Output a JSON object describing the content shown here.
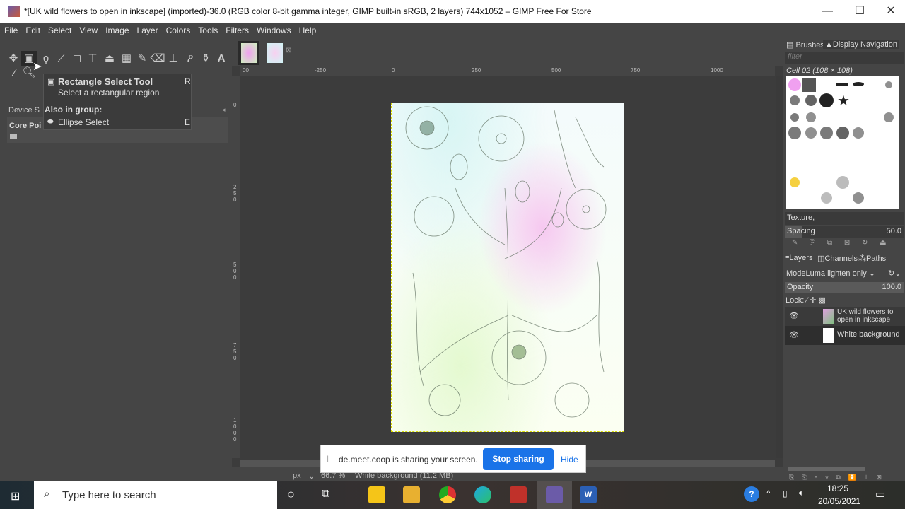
{
  "window": {
    "title": "*[UK wild flowers to open in inkscape] (imported)-36.0 (RGB color 8-bit gamma integer, GIMP built-in sRGB, 2 layers) 744x1052 – GIMP Free For Store",
    "minimize": "—",
    "maximize": "☐",
    "close": "✕"
  },
  "menu": [
    "File",
    "Edit",
    "Select",
    "View",
    "Image",
    "Layer",
    "Colors",
    "Tools",
    "Filters",
    "Windows",
    "Help"
  ],
  "tooltip": {
    "title": "Rectangle Select Tool",
    "shortcut": "R",
    "description": "Select a rectangular region",
    "group_label": "Also in group:",
    "group_item": "Ellipse Select",
    "group_shortcut": "E"
  },
  "device_status": {
    "tab": "Device S",
    "core": "Core Poi"
  },
  "rulers": {
    "h": [
      "-250",
      "0",
      "250",
      "500",
      "750",
      "1000"
    ],
    "v": [
      "0",
      "250",
      "500",
      "750",
      "1000"
    ],
    "origin": "00"
  },
  "right": {
    "tabs": [
      "Brushes",
      "Display Navigation"
    ],
    "filter_placeholder": "filter",
    "brush_name": "Cell 02 (108 × 108)",
    "tag": "Texture,",
    "spacing_label": "Spacing",
    "spacing_value": "50.0",
    "spacing_fraction": 0.15,
    "layer_tabs": [
      "Layers",
      "Channels",
      "Paths"
    ],
    "mode_label": "Mode",
    "mode_value": "Luma lighten only",
    "opacity_label": "Opacity",
    "opacity_value": "100.0",
    "lock_label": "Lock:",
    "layers": [
      {
        "name": "UK wild flowers to open in inkscape"
      },
      {
        "name": "White background"
      }
    ]
  },
  "status": {
    "unit": "px",
    "zoom": "66.7 %",
    "info": "White background (11.2 MB)"
  },
  "share": {
    "message": "de.meet.coop is sharing your screen.",
    "stop": "Stop sharing",
    "hide": "Hide",
    "accent": "#1a73e8"
  },
  "taskbar": {
    "search_placeholder": "Type here to search",
    "time": "18:25",
    "date": "20/05/2021"
  }
}
